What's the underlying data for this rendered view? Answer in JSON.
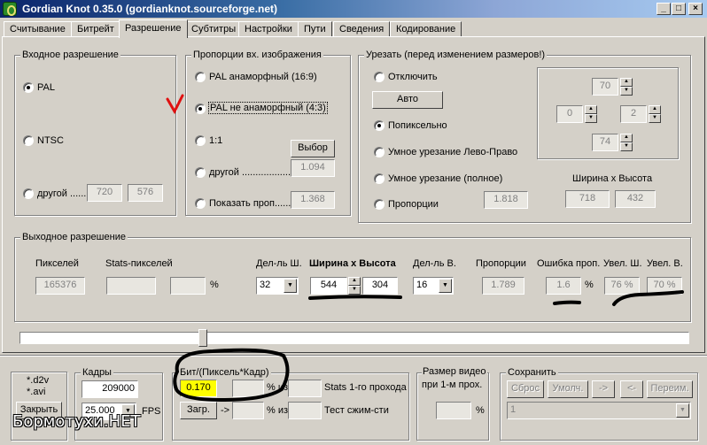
{
  "window": {
    "title": "Gordian Knot 0.35.0  (gordianknot.sourceforge.net)",
    "min_glyph": "_",
    "max_glyph": "□",
    "close_glyph": "×"
  },
  "tabs": [
    "Считывание",
    "Битрейт",
    "Разрешение",
    "Субтитры",
    "Настройки",
    "Пути",
    "Сведения",
    "Кодирование"
  ],
  "input_res": {
    "legend": "Входное разрешение",
    "pal": "PAL",
    "ntsc": "NTSC",
    "other": "другой .......",
    "other_w": "720",
    "other_h": "576"
  },
  "aspect": {
    "legend": "Пропорции вх. изображения",
    "pal_anamorphic": "PAL анаморфный (16:9)",
    "pal_non_anamorphic": "PAL не анаморфный (4:3)",
    "one_to_one": "1:1",
    "choose_button": "Выбор",
    "other": "другой ...................",
    "other_value": "1.094",
    "show_prop": "Показать проп......",
    "show_prop_value": "1.368"
  },
  "crop": {
    "legend": "Урезать (перед изменением размеров!)",
    "disable": "Отключить",
    "auto_button": "Авто",
    "per_pixel": "Попиксельно",
    "smart_lr": "Умное урезание Лево-Право",
    "smart_full": "Умное урезание (полное)",
    "proportions": "Пропорции",
    "proportions_value": "1.818",
    "top": "70",
    "left": "0",
    "right": "2",
    "bottom": "74",
    "wh_label": "Ширина х Высота",
    "width": "718",
    "height": "432"
  },
  "output_res": {
    "legend": "Выходное разрешение",
    "pixels_label": "Пикселей",
    "pixels_value": "165376",
    "stats_label": "Stats-пикселей",
    "percent": "%",
    "div_w_label": "Дел-ль Ш.",
    "div_w_value": "32",
    "wh_label": "Ширина х Высота",
    "width": "544",
    "height": "304",
    "div_h_label": "Дел-ль В.",
    "div_h_value": "16",
    "prop_label": "Пропорции",
    "prop_value": "1.789",
    "err_label": "Ошибка проп.",
    "err_value": "1.6",
    "err_pct": "%",
    "inc_w_label": "Увел. Ш.",
    "inc_w_value": "76 %",
    "inc_h_label": "Увел. В.",
    "inc_h_value": "70 %"
  },
  "bottom": {
    "files_line1": "*.d2v",
    "files_line2": "*.avi",
    "close_button": "Закрыть",
    "frames_legend": "Кадры",
    "frames_value": "209000",
    "fps_value": "25.000",
    "fps_label": "FPS",
    "bits_legend": "Бит/(Пиксель*Кадр)",
    "bits_value": "0.170",
    "pct_of": "% из",
    "stats_label": "Stats 1-го прохода",
    "load_button": "Загр.",
    "arrow": "->",
    "test_label": "Тест сжим-сти",
    "video_size_line1": "Размер видео",
    "video_size_line2": "при 1-м прох.",
    "video_pct": "%",
    "save_legend": "Сохранить",
    "reset_button": "Сброс",
    "default_button": "Умолч.",
    "right_arrow_button": "->",
    "left_arrow_button": "<-",
    "rename_button": "Переим.",
    "save_combo_value": "1"
  },
  "watermark": "Бормотухи.НЕТ"
}
